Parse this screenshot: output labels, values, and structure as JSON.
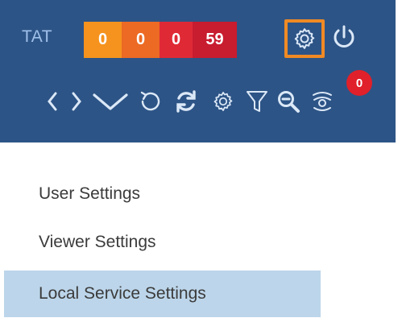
{
  "toolbar": {
    "tat_label": "TAT",
    "counters": [
      {
        "value": "0",
        "color": "#f5931e"
      },
      {
        "value": "0",
        "color": "#ec6a24"
      },
      {
        "value": "0",
        "color": "#df2a36"
      },
      {
        "value": "59",
        "color": "#c81c2f"
      }
    ],
    "notification_count": "0",
    "icons": [
      "settings-icon",
      "power-icon",
      "chevron-left-icon",
      "chevron-right-icon",
      "chevron-down-icon",
      "undo-icon",
      "refresh-icon",
      "gear-icon",
      "filter-icon",
      "zoom-out-icon",
      "eye-icon"
    ]
  },
  "menu": {
    "items": [
      {
        "label": "User Settings"
      },
      {
        "label": "Viewer Settings"
      },
      {
        "label": "Local Service Settings",
        "active": true
      }
    ]
  },
  "colors": {
    "toolbar_bg": "#2d5486",
    "highlight_border": "#f08a24",
    "active_menu_bg": "#bcd5ea",
    "badge_bg": "#e0202a"
  }
}
